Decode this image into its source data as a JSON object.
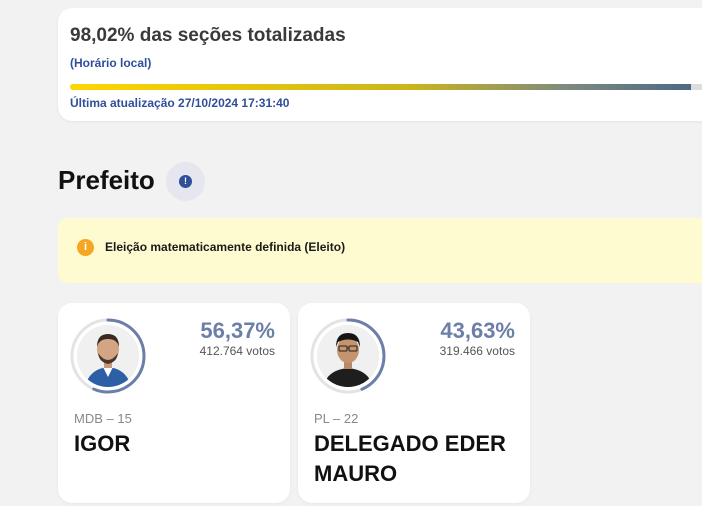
{
  "status": {
    "title": "98,02% das seções totalizadas",
    "timezone_note": "(Horário local)",
    "last_update": "Última atualização 27/10/2024 17:31:40",
    "progress_fraction": 0.9802,
    "colors": {
      "text_accent": "#2f4f9a",
      "bar_start": "#ffd600",
      "bar_end": "#4c6a85"
    }
  },
  "office": {
    "title": "Prefeito",
    "info_icon": "info-icon",
    "info_glyph": "!"
  },
  "alert": {
    "icon": "info-circle-icon",
    "icon_glyph": "i",
    "text": "Eleição matematicamente definida (Eleito)",
    "background": "#fffbd0"
  },
  "candidates": [
    {
      "party": "MDB – 15",
      "name": "IGOR",
      "percent": "56,37%",
      "votes": "412.764 votos",
      "ring_fraction": 0.5637
    },
    {
      "party": "PL – 22",
      "name": "DELEGADO EDER MAURO",
      "percent": "43,63%",
      "votes": "319.466 votos",
      "ring_fraction": 0.4363
    }
  ]
}
